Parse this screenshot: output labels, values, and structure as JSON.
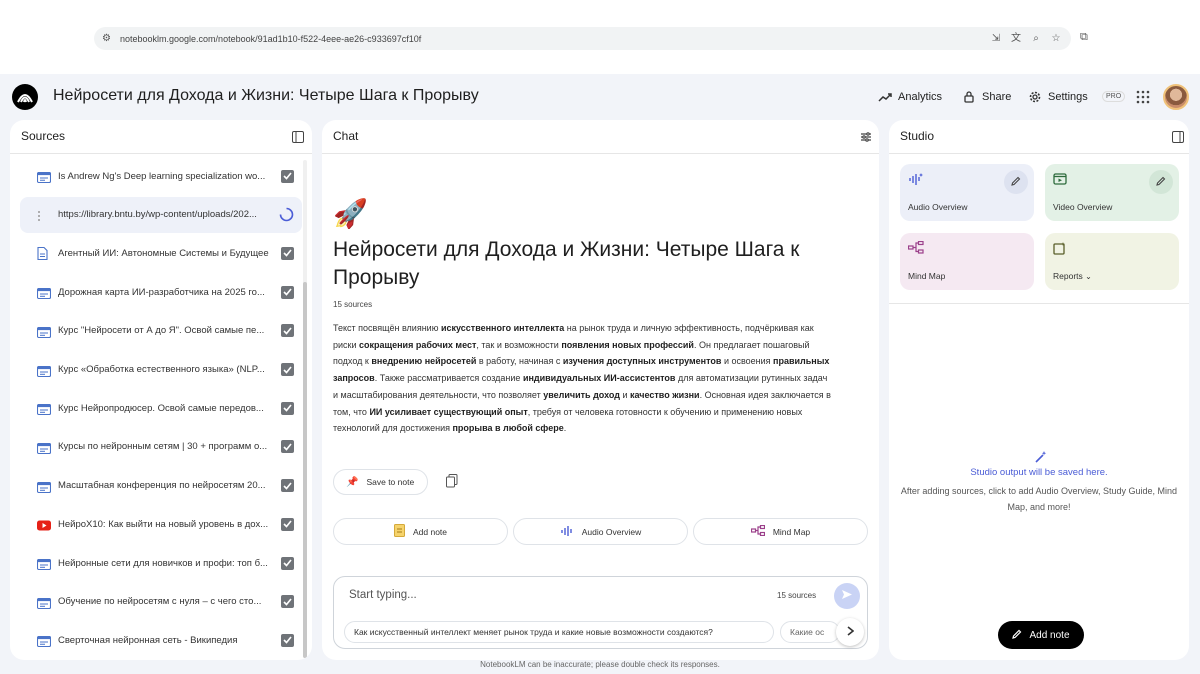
{
  "browser": {
    "url": "notebooklm.google.com/notebook/91ad1b10-f522-4eee-ae26-c933697cf10f"
  },
  "header": {
    "title": "Нейросети для Дохода и Жизни: Четыре Шага к Прорыву",
    "analytics_label": "Analytics",
    "share_label": "Share",
    "settings_label": "Settings",
    "pro_badge": "PRO"
  },
  "sources": {
    "title": "Sources",
    "items": [
      {
        "label": "Is Andrew Ng's Deep learning specialization wo...",
        "icon": "web-icon",
        "state": "checked"
      },
      {
        "label": "https://library.bntu.by/wp-content/uploads/202...",
        "icon": "drag-icon",
        "state": "loading"
      },
      {
        "label": "Агентный ИИ: Автономные Системы и Будущее",
        "icon": "doc-icon",
        "state": "checked"
      },
      {
        "label": "Дорожная карта ИИ-разработчика на 2025 го...",
        "icon": "web-icon",
        "state": "checked"
      },
      {
        "label": "Курс \"Нейросети от А до Я\". Освой самые пе...",
        "icon": "web-icon",
        "state": "checked"
      },
      {
        "label": "Курс «Обработка естественного языка» (NLP...",
        "icon": "web-icon",
        "state": "checked"
      },
      {
        "label": "Курс Нейропродюсер. Освой самые передов...",
        "icon": "web-icon",
        "state": "checked"
      },
      {
        "label": "Курсы по нейронным сетям | 30 + программ о...",
        "icon": "web-icon",
        "state": "checked"
      },
      {
        "label": "Масштабная конференция по нейросетям 20...",
        "icon": "web-icon",
        "state": "checked"
      },
      {
        "label": "НейроX10: Как выйти на новый уровень в дох...",
        "icon": "youtube-icon",
        "state": "checked"
      },
      {
        "label": "Нейронные сети для новичков и профи: топ б...",
        "icon": "web-icon",
        "state": "checked"
      },
      {
        "label": "Обучение по нейросетям с нуля – с чего сто...",
        "icon": "web-icon",
        "state": "checked"
      },
      {
        "label": "Сверточная нейронная сеть - Википедия",
        "icon": "web-icon",
        "state": "checked"
      }
    ]
  },
  "chat": {
    "title": "Chat",
    "emoji": "🚀",
    "notebook_title": "Нейросети для Дохода и Жизни: Четыре Шага к Прорыву",
    "source_count": "15 sources",
    "save_to_note": "Save to note",
    "actions": {
      "add_note": "Add note",
      "audio_overview": "Audio Overview",
      "mind_map": "Mind Map"
    },
    "input_placeholder": "Start typing...",
    "input_sources": "15 sources",
    "suggestions": [
      "Как искусственный интеллект меняет рынок труда и какие новые возможности создаются?",
      "Какие ос"
    ],
    "summary": [
      {
        "t": "Текст посвящён влиянию ",
        "b": false
      },
      {
        "t": "искусственного интеллекта",
        "b": true
      },
      {
        "t": " на рынок труда и личную эффективность, подчёркивая как риски ",
        "b": false
      },
      {
        "t": "сокращения рабочих мест",
        "b": true
      },
      {
        "t": ", так и возможности ",
        "b": false
      },
      {
        "t": "появления новых профессий",
        "b": true
      },
      {
        "t": ". Он предлагает пошаговый подход к ",
        "b": false
      },
      {
        "t": "внедрению нейросетей",
        "b": true
      },
      {
        "t": " в работу, начиная с ",
        "b": false
      },
      {
        "t": "изучения доступных инструментов",
        "b": true
      },
      {
        "t": " и освоения ",
        "b": false
      },
      {
        "t": "правильных запросов",
        "b": true
      },
      {
        "t": ". Также рассматривается создание ",
        "b": false
      },
      {
        "t": "индивидуальных ИИ-ассистентов",
        "b": true
      },
      {
        "t": " для автоматизации рутинных задач и масштабирования деятельности, что позволяет ",
        "b": false
      },
      {
        "t": "увеличить доход",
        "b": true
      },
      {
        "t": " и ",
        "b": false
      },
      {
        "t": "качество жизни",
        "b": true
      },
      {
        "t": ". Основная идея заключается в том, что ",
        "b": false
      },
      {
        "t": "ИИ усиливает существующий опыт",
        "b": true
      },
      {
        "t": ", требуя от человека готовности к обучению и применению новых технологий для достижения ",
        "b": false
      },
      {
        "t": "прорыва в любой сфере",
        "b": true
      },
      {
        "t": ".",
        "b": false
      }
    ]
  },
  "studio": {
    "title": "Studio",
    "cards": {
      "audio": "Audio Overview",
      "video": "Video Overview",
      "mind_map": "Mind Map",
      "reports": "Reports"
    },
    "empty_title": "Studio output will be saved here.",
    "empty_text": "After adding sources, click to add Audio Overview, Study Guide, Mind Map, and more!",
    "add_note": "Add note"
  },
  "footer": "NotebookLM can be inaccurate; please double check its responses.",
  "colors": {
    "audio_card": "#eceff8",
    "video_card": "#e3f1e6",
    "mindmap_card": "#f5e9f2",
    "reports_card": "#f1f3e4",
    "accent": "#4a5cd6"
  }
}
